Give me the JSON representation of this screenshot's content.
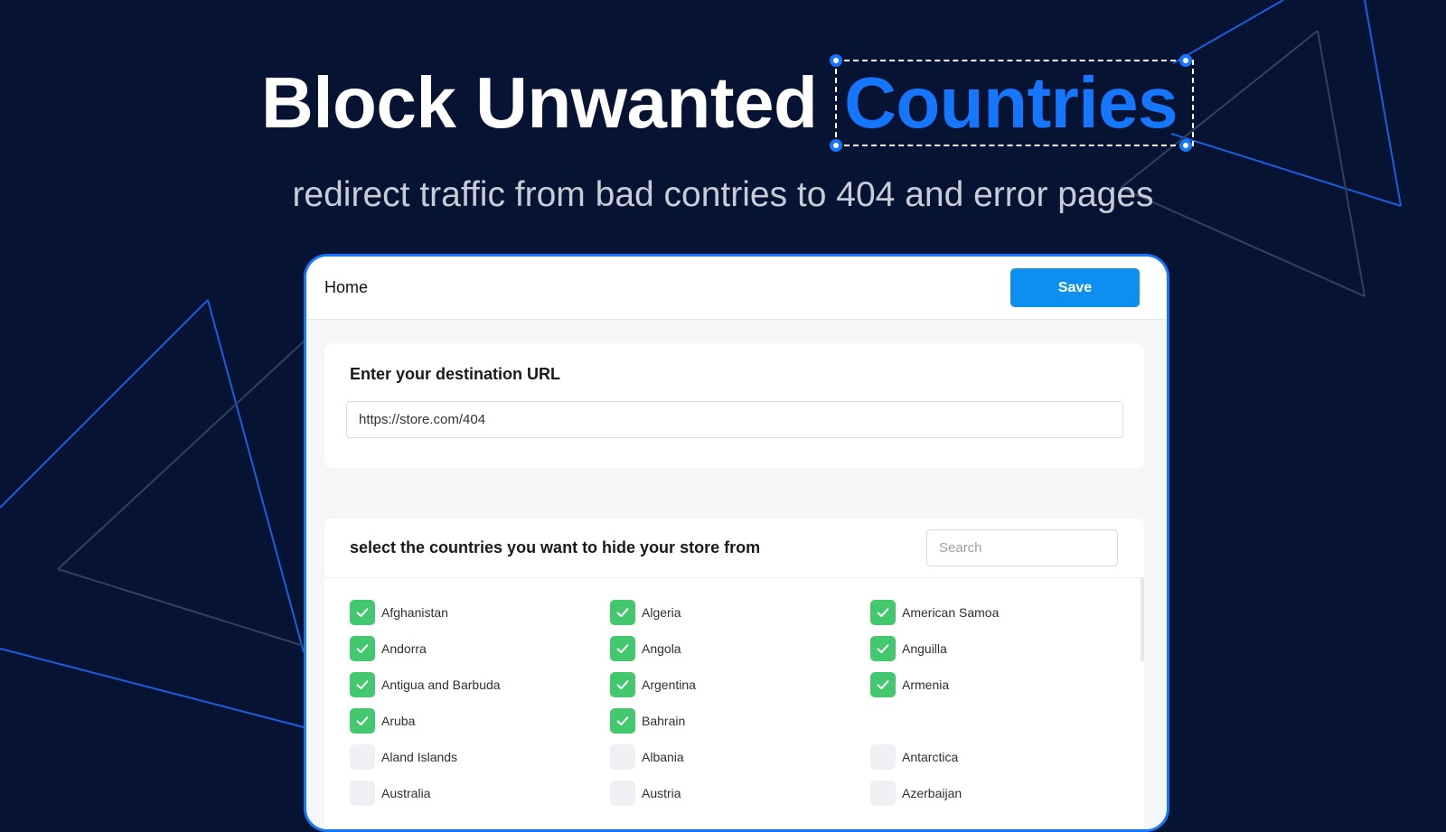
{
  "hero": {
    "title_main": "Block Unwanted",
    "title_accent": "Countries",
    "subtitle": "redirect traffic from bad contries to 404 and error pages"
  },
  "app": {
    "header": {
      "home_label": "Home",
      "save_label": "Save"
    },
    "url_card": {
      "title": "Enter your destination URL",
      "url_value": "https://store.com/404"
    },
    "countries_card": {
      "title": "select the countries you want to hide your store from",
      "search_placeholder": "Search",
      "items": [
        {
          "label": "Afghanistan",
          "checked": true
        },
        {
          "label": "Algeria",
          "checked": true
        },
        {
          "label": "American Samoa",
          "checked": true
        },
        {
          "label": "Andorra",
          "checked": true
        },
        {
          "label": "Angola",
          "checked": true
        },
        {
          "label": "Anguilla",
          "checked": true
        },
        {
          "label": "Antigua and Barbuda",
          "checked": true
        },
        {
          "label": "Argentina",
          "checked": true
        },
        {
          "label": "Armenia",
          "checked": true
        },
        {
          "label": "Aruba",
          "checked": true
        },
        {
          "label": "Bahrain",
          "checked": true
        },
        {
          "label": "",
          "checked": null
        },
        {
          "label": "Aland Islands",
          "checked": false
        },
        {
          "label": "Albania",
          "checked": false
        },
        {
          "label": "Antarctica",
          "checked": false
        },
        {
          "label": "Australia",
          "checked": false
        },
        {
          "label": "Austria",
          "checked": false
        },
        {
          "label": "Azerbaijan",
          "checked": false
        }
      ]
    }
  },
  "colors": {
    "background": "#061333",
    "accent": "#1577ff",
    "save_button": "#0d8ff0",
    "checked": "#43c86e",
    "unchecked": "#eef0f3"
  },
  "icons": {
    "checkbox_mark": "check-icon"
  }
}
